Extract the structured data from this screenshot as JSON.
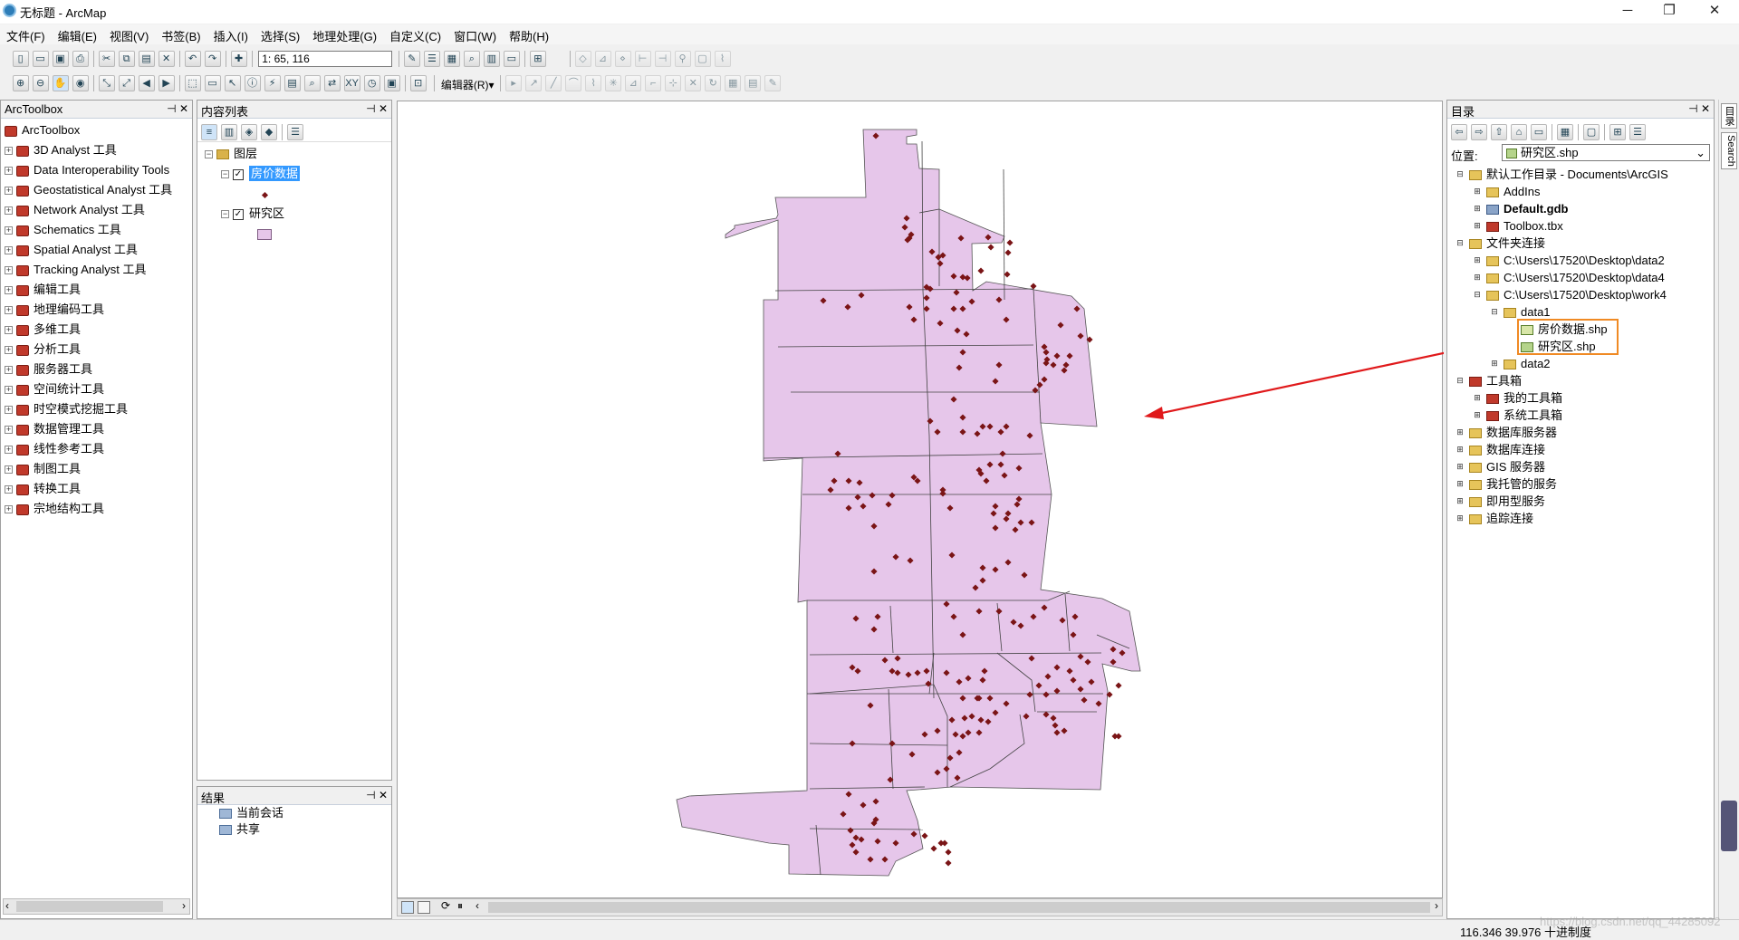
{
  "window": {
    "title": "无标题 - ArcMap",
    "min": "─",
    "max": "❐",
    "close": "✕"
  },
  "menu": [
    "文件(F)",
    "编辑(E)",
    "视图(V)",
    "书签(B)",
    "插入(I)",
    "选择(S)",
    "地理处理(G)",
    "自定义(C)",
    "窗口(W)",
    "帮助(H)"
  ],
  "toolbar": {
    "scale": "1: 65, 116",
    "editor": "编辑器(R)▾"
  },
  "arctoolbox": {
    "title": "ArcToolbox",
    "root": "ArcToolbox",
    "items": [
      "3D Analyst 工具",
      "Data Interoperability Tools",
      "Geostatistical Analyst 工具",
      "Network Analyst 工具",
      "Schematics 工具",
      "Spatial Analyst 工具",
      "Tracking Analyst 工具",
      "编辑工具",
      "地理编码工具",
      "多维工具",
      "分析工具",
      "服务器工具",
      "空间统计工具",
      "时空模式挖掘工具",
      "数据管理工具",
      "线性参考工具",
      "制图工具",
      "转换工具",
      "宗地结构工具"
    ]
  },
  "toc": {
    "title": "内容列表",
    "group": "图层",
    "layers": [
      {
        "name": "房价数据",
        "checked": true
      },
      {
        "name": "研究区",
        "checked": true
      }
    ]
  },
  "results": {
    "title": "结果",
    "items": [
      "当前会话",
      "共享"
    ]
  },
  "catalog": {
    "title": "目录",
    "location_label": "位置:",
    "location_value": "研究区.shp",
    "tree": [
      {
        "label": "默认工作目录 - Documents\\ArcGIS",
        "level": 0,
        "exp": "⊟",
        "type": "folder"
      },
      {
        "label": "AddIns",
        "level": 1,
        "exp": "⊞",
        "type": "folder"
      },
      {
        "label": "Default.gdb",
        "level": 1,
        "exp": "⊞",
        "type": "gdb",
        "bold": true
      },
      {
        "label": "Toolbox.tbx",
        "level": 1,
        "exp": "⊞",
        "type": "tbx"
      },
      {
        "label": "文件夹连接",
        "level": 0,
        "exp": "⊟",
        "type": "folder"
      },
      {
        "label": "C:\\Users\\17520\\Desktop\\data2",
        "level": 1,
        "exp": "⊞",
        "type": "folder"
      },
      {
        "label": "C:\\Users\\17520\\Desktop\\data4",
        "level": 1,
        "exp": "⊞",
        "type": "folder"
      },
      {
        "label": "C:\\Users\\17520\\Desktop\\work4",
        "level": 1,
        "exp": "⊟",
        "type": "folder"
      },
      {
        "label": "data1",
        "level": 2,
        "exp": "⊟",
        "type": "folder"
      },
      {
        "label": "房价数据.shp",
        "level": 3,
        "exp": "",
        "type": "shp-pt"
      },
      {
        "label": "研究区.shp",
        "level": 3,
        "exp": "",
        "type": "shp-poly"
      },
      {
        "label": "data2",
        "level": 2,
        "exp": "⊞",
        "type": "folder"
      },
      {
        "label": "工具箱",
        "level": 0,
        "exp": "⊟",
        "type": "tbx"
      },
      {
        "label": "我的工具箱",
        "level": 1,
        "exp": "⊞",
        "type": "tbx"
      },
      {
        "label": "系统工具箱",
        "level": 1,
        "exp": "⊞",
        "type": "tbx"
      },
      {
        "label": "数据库服务器",
        "level": 0,
        "exp": "⊞",
        "type": "folder"
      },
      {
        "label": "数据库连接",
        "level": 0,
        "exp": "⊞",
        "type": "folder"
      },
      {
        "label": "GIS 服务器",
        "level": 0,
        "exp": "⊞",
        "type": "folder"
      },
      {
        "label": "我托管的服务",
        "level": 0,
        "exp": "⊞",
        "type": "folder"
      },
      {
        "label": "即用型服务",
        "level": 0,
        "exp": "⊞",
        "type": "folder"
      },
      {
        "label": "追踪连接",
        "level": 0,
        "exp": "⊞",
        "type": "folder"
      }
    ]
  },
  "side_tabs": [
    "目录",
    "Search"
  ],
  "status": {
    "coords": "116.346  39.976 十进制度",
    "watermark": "https://blog.csdn.net/qq_44285092"
  },
  "colors": {
    "polygon_fill": "#e6c6ea",
    "point": "#7a1416",
    "arrow": "#e0191b",
    "highlight": "#f08a24",
    "selection": "#3399ff"
  }
}
